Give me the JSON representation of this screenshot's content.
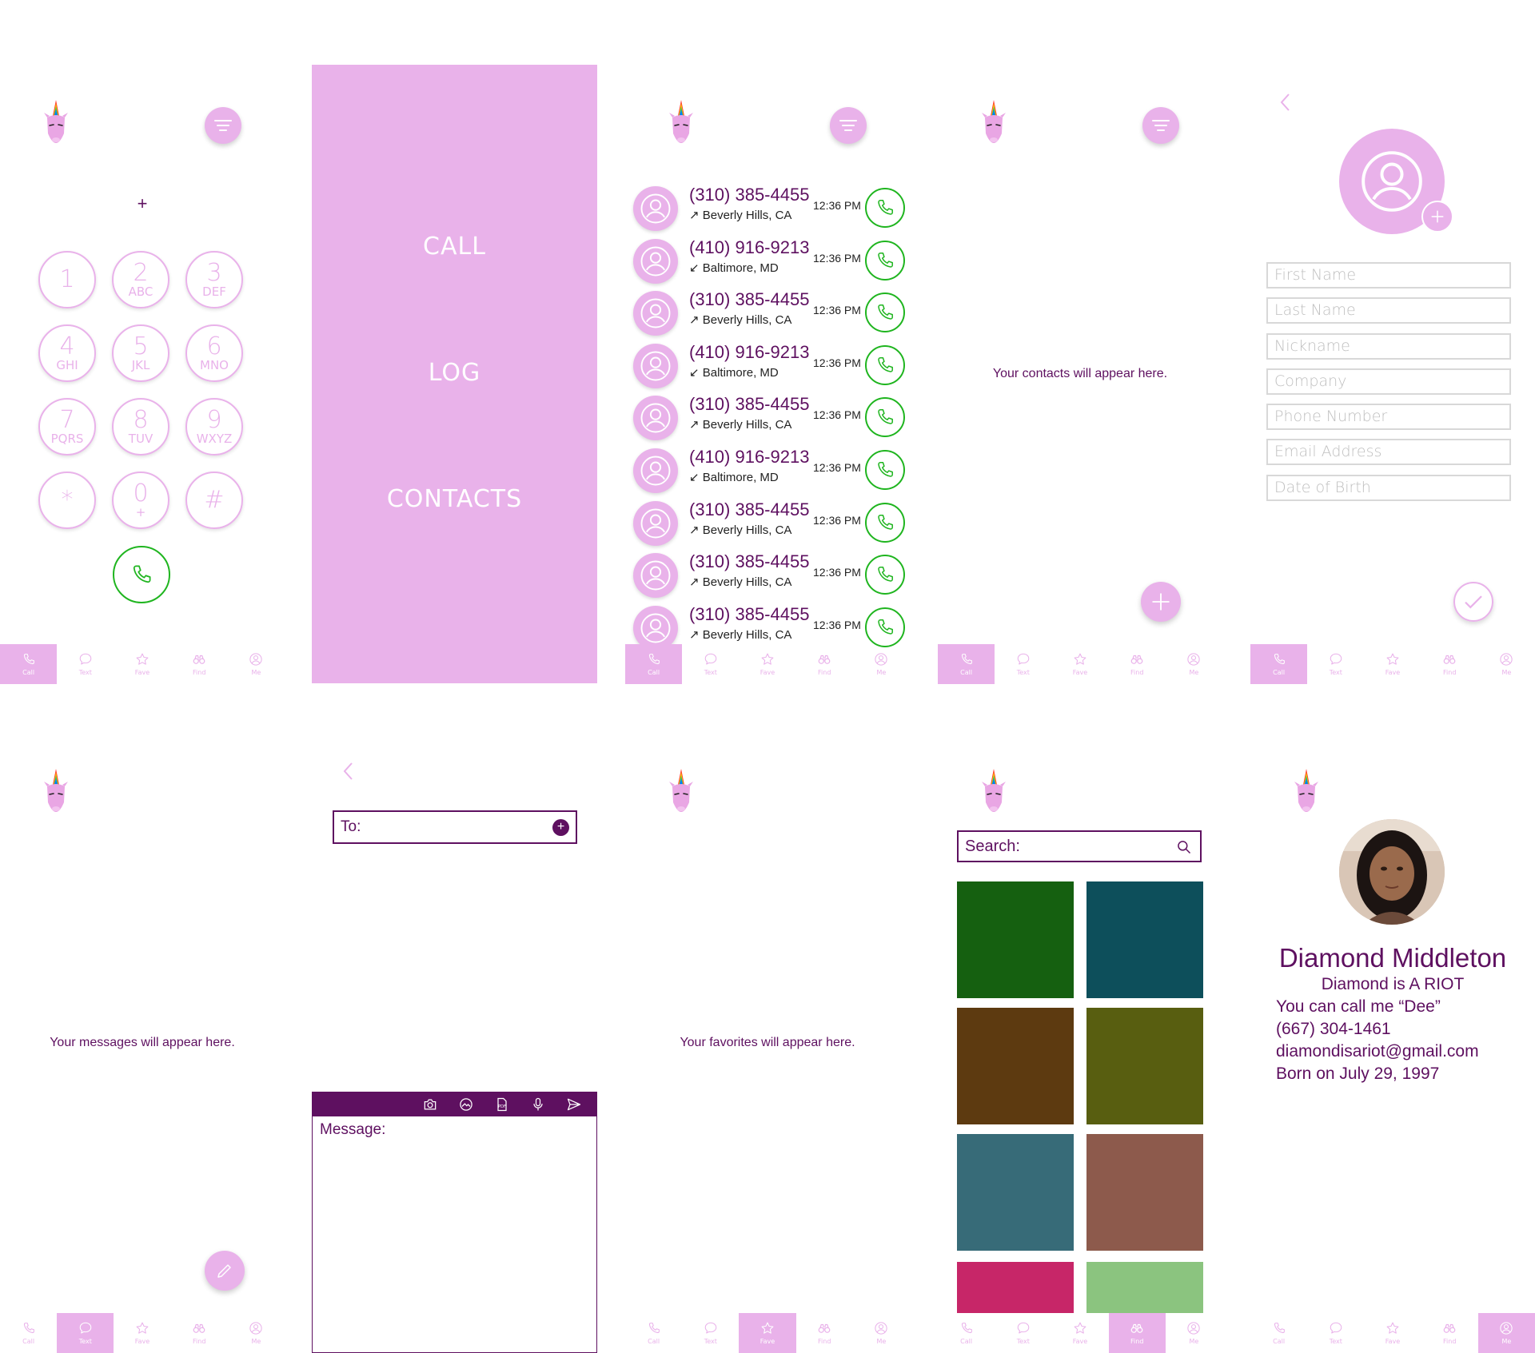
{
  "colors": {
    "accent": "#e9b2ea",
    "deep_purple": "#5e1060",
    "call_green": "#1fb51f"
  },
  "tabs": [
    {
      "label": "Call",
      "icon": "phone-icon"
    },
    {
      "label": "Text",
      "icon": "chat-bubble-icon"
    },
    {
      "label": "Fave",
      "icon": "star-icon"
    },
    {
      "label": "Find",
      "icon": "binoculars-icon"
    },
    {
      "label": "Me",
      "icon": "user-circle-icon"
    }
  ],
  "dialer": {
    "display": "+",
    "keys": [
      {
        "digit": "1",
        "letters": ""
      },
      {
        "digit": "2",
        "letters": "ABC"
      },
      {
        "digit": "3",
        "letters": "DEF"
      },
      {
        "digit": "4",
        "letters": "GHI"
      },
      {
        "digit": "5",
        "letters": "JKL"
      },
      {
        "digit": "6",
        "letters": "MNO"
      },
      {
        "digit": "7",
        "letters": "PQRS"
      },
      {
        "digit": "8",
        "letters": "TUV"
      },
      {
        "digit": "9",
        "letters": "WXYZ"
      },
      {
        "digit": "*",
        "letters": ""
      },
      {
        "digit": "0",
        "letters": "+"
      },
      {
        "digit": "#",
        "letters": ""
      }
    ]
  },
  "menu": {
    "items": [
      "CALL",
      "LOG",
      "CONTACTS"
    ]
  },
  "log": {
    "entries": [
      {
        "number": "(310) 385-4455",
        "location": "↗ Beverly Hills, CA",
        "time": "12:36 PM"
      },
      {
        "number": "(410) 916-9213",
        "location": "↙ Baltimore, MD",
        "time": "12:36 PM"
      },
      {
        "number": "(310) 385-4455",
        "location": "↗ Beverly Hills, CA",
        "time": "12:36 PM"
      },
      {
        "number": "(410) 916-9213",
        "location": "↙ Baltimore, MD",
        "time": "12:36 PM"
      },
      {
        "number": "(310) 385-4455",
        "location": "↗ Beverly Hills, CA",
        "time": "12:36 PM"
      },
      {
        "number": "(410) 916-9213",
        "location": "↙ Baltimore, MD",
        "time": "12:36 PM"
      },
      {
        "number": "(310) 385-4455",
        "location": "↗ Beverly Hills, CA",
        "time": "12:36 PM"
      },
      {
        "number": "(310) 385-4455",
        "location": "↗ Beverly Hills, CA",
        "time": "12:36 PM"
      },
      {
        "number": "(310) 385-4455",
        "location": "↗ Beverly Hills, CA",
        "time": "12:36 PM"
      }
    ]
  },
  "contacts": {
    "empty_message": "Your contacts will appear here."
  },
  "add_contact": {
    "fields": [
      "First Name",
      "Last Name",
      "Nickname",
      "Company",
      "Phone Number",
      "Email Address",
      "Date of Birth"
    ]
  },
  "messages": {
    "empty_message": "Your messages will appear here."
  },
  "compose": {
    "to_placeholder": "To:",
    "message_placeholder": "Message:",
    "toolbar_icons": [
      "camera-icon",
      "gallery-icon",
      "pdf-icon",
      "microphone-icon",
      "send-icon"
    ]
  },
  "favorites": {
    "empty_message": "Your favorites will appear here."
  },
  "find": {
    "search_placeholder": "Search:",
    "swatches": [
      "#156010",
      "#0d4f5b",
      "#5d3a10",
      "#585e10",
      "#376b78",
      "#8d5a4c",
      "#c72668",
      "#8bc47f"
    ]
  },
  "profile": {
    "name": "Diamond Middleton",
    "tagline": "Diamond is A RIOT",
    "nickname": "You can call me “Dee”",
    "phone": "(667) 304-1461",
    "email": "diamondisariot@gmail.com",
    "birthday": "Born on July 29, 1997"
  }
}
